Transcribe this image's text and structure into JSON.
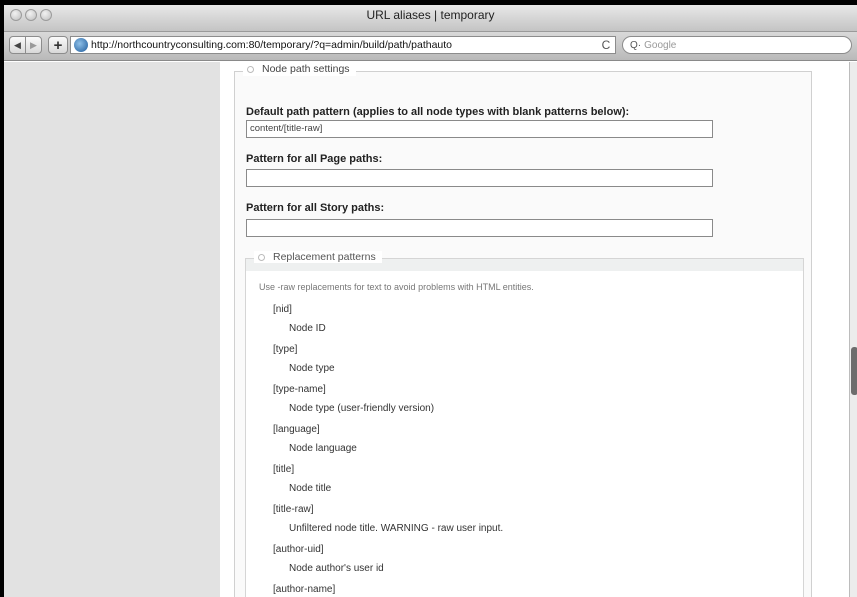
{
  "window": {
    "title": "URL aliases | temporary"
  },
  "toolbar": {
    "back_glyph": "◀",
    "forward_glyph": "▶",
    "add_glyph": "+",
    "url": "http://northcountryconsulting.com:80/temporary/?q=admin/build/path/pathauto",
    "reload_glyph": "C",
    "search_glyph": "Q·",
    "search_placeholder": "Google"
  },
  "section": {
    "legend": "Node path settings"
  },
  "fields": [
    {
      "label": "Default path pattern (applies to all node types with blank patterns below):",
      "value": "content/[title-raw]"
    },
    {
      "label": "Pattern for all Page paths:",
      "value": ""
    },
    {
      "label": "Pattern for all Story paths:",
      "value": ""
    }
  ],
  "replacement": {
    "legend": "Replacement patterns",
    "description": "Use -raw replacements for text to avoid problems with HTML entities.",
    "tokens": [
      {
        "token": "[nid]",
        "desc": "Node ID"
      },
      {
        "token": "[type]",
        "desc": "Node type"
      },
      {
        "token": "[type-name]",
        "desc": "Node type (user-friendly version)"
      },
      {
        "token": "[language]",
        "desc": "Node language"
      },
      {
        "token": "[title]",
        "desc": "Node title"
      },
      {
        "token": "[title-raw]",
        "desc": "Unfiltered node title. WARNING - raw user input."
      },
      {
        "token": "[author-uid]",
        "desc": "Node author's user id"
      },
      {
        "token": "[author-name]",
        "desc": ""
      }
    ]
  }
}
